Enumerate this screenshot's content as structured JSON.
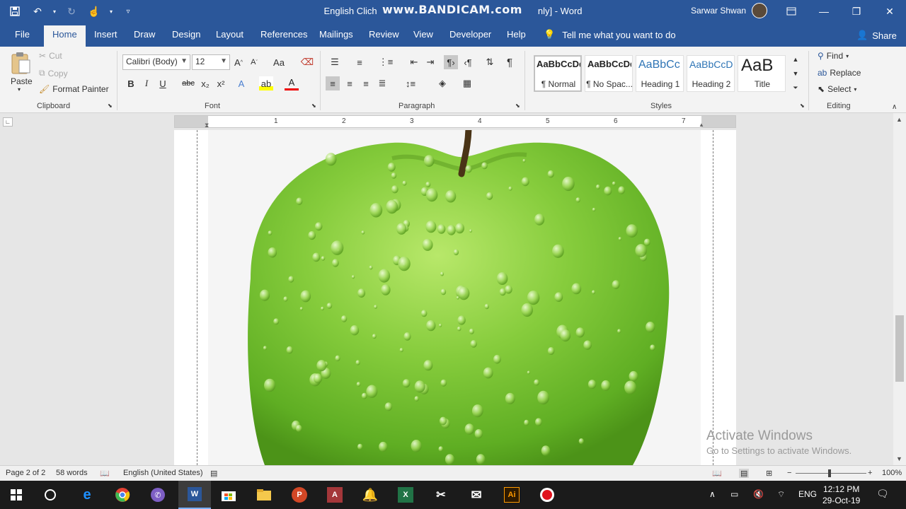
{
  "window": {
    "title": "English Clich",
    "title_suffix": "nly]  -  Word",
    "recorder_watermark": "www.BANDICAM.com",
    "user_name": "Sarwar Shwan"
  },
  "tabs": [
    "File",
    "Home",
    "Insert",
    "Draw",
    "Design",
    "Layout",
    "References",
    "Mailings",
    "Review",
    "View",
    "Developer",
    "Help"
  ],
  "tell_me": "Tell me what you want to do",
  "share": "Share",
  "clipboard": {
    "paste": "Paste",
    "cut": "Cut",
    "copy": "Copy",
    "format_painter": "Format Painter",
    "label": "Clipboard"
  },
  "font": {
    "family": "Calibri (Body)",
    "size": "12",
    "label": "Font",
    "bold": "B",
    "italic": "I",
    "underline": "U",
    "strike": "abc",
    "subscript": "x₂",
    "superscript": "x²",
    "grow": "A^",
    "shrink": "Aˇ",
    "change_case": "Aa"
  },
  "paragraph": {
    "label": "Paragraph",
    "pilcrow": "¶"
  },
  "styles": {
    "label": "Styles",
    "items": [
      {
        "preview": "AaBbCcDd",
        "name": "¶ Normal"
      },
      {
        "preview": "AaBbCcDd",
        "name": "¶ No Spac..."
      },
      {
        "preview": "AaBbCc",
        "name": "Heading 1"
      },
      {
        "preview": "AaBbCcD",
        "name": "Heading 2"
      },
      {
        "preview": "AaB",
        "name": "Title"
      }
    ]
  },
  "editing": {
    "label": "Editing",
    "find": "Find",
    "replace": "Replace",
    "select": "Select"
  },
  "ruler_numbers": [
    "1",
    "2",
    "3",
    "4",
    "5",
    "6",
    "7"
  ],
  "activate": {
    "line1": "Activate Windows",
    "line2": "Go to Settings to activate Windows."
  },
  "status": {
    "page": "Page 2 of 2",
    "words": "58 words",
    "language": "English (United States)",
    "zoom": "100%"
  },
  "taskbar": {
    "lang": "ENG",
    "time": "12:12 PM",
    "date": "29-Oct-19"
  },
  "colors": {
    "word_blue": "#2b579a",
    "apple_green": "#7cc53a"
  }
}
